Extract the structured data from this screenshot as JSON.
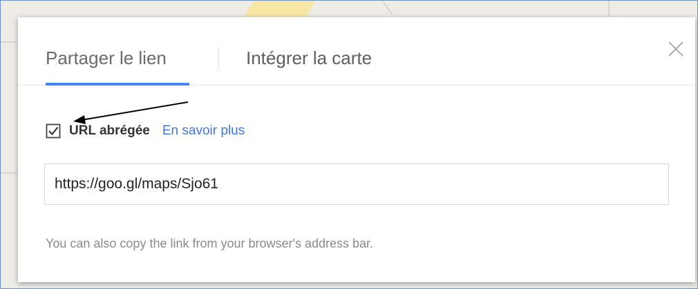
{
  "tabs": [
    {
      "label": "Partager le lien",
      "active": true
    },
    {
      "label": "Intégrer la carte",
      "active": false
    }
  ],
  "short_url": {
    "checked": true,
    "label": "URL abrégée",
    "learn_more": "En savoir plus"
  },
  "link": {
    "value": "https://goo.gl/maps/Sjo61"
  },
  "help_text": "You can also copy the link from your browser's address bar.",
  "icons": {
    "close": "close-icon",
    "checkbox": "checkbox-checked-icon"
  },
  "colors": {
    "accent": "#4285f4",
    "link": "#3b78e7",
    "tab_text": "#6b6b6b",
    "help_text": "#8a8a8a"
  }
}
